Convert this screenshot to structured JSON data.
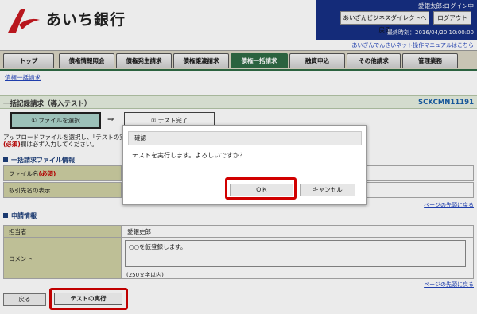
{
  "header": {
    "bank_name": "あいち銀行",
    "user": "愛銀太郎:ログイン中",
    "back_label": "あいぎんビジネスダイレクトへ戻る",
    "logout_label": "ログアウト",
    "last_login": "最終時刻：2016/04/20 10:00:00",
    "manual_link": "あいぎんでんさいネット操作マニュアルはこちら"
  },
  "tabs": [
    "トップ",
    "債権情報照会",
    "債権発生請求",
    "債権譲渡請求",
    "債権一括請求",
    "融資申込",
    "その他請求",
    "管理業務"
  ],
  "active_tab": "債権一括請求",
  "subnav": "債権一括請求",
  "page": {
    "title": "一括記録請求（導入テスト）",
    "screen_id": "SCKCMN11191"
  },
  "steps": {
    "step1": "① ファイルを選択",
    "arrow": "⇒",
    "step2": "② テスト完了"
  },
  "instructions": {
    "line1": "アップロードファイルを選択し、「テストの実行」",
    "req": "(必須)",
    "line2": "欄は必ず入力してください。"
  },
  "file_section": {
    "heading": "一括請求ファイル情報",
    "rows": [
      {
        "label": "ファイル名",
        "req": "(必須)",
        "value": ""
      },
      {
        "label": "取引先名の表示",
        "value": ""
      }
    ],
    "pagetop": "ページの先頭に戻る"
  },
  "apply_section": {
    "heading": "申請情報",
    "rows": [
      {
        "label": "担当者",
        "value": "愛銀史郎"
      },
      {
        "label": "コメント",
        "value": ""
      }
    ],
    "comment_text": "○○を仮登録します。",
    "limit": "(250文字以内)",
    "pagetop": "ページの先頭に戻る"
  },
  "buttons": {
    "return": "戻る",
    "execute": "テストの実行"
  },
  "modal": {
    "title": "確認",
    "message": "テストを実行します。よろしいですか？",
    "ok": "ＯＫ",
    "cancel": "キャンセル"
  },
  "colors": {
    "header_navy": "#162f84",
    "tab_active": "#2f6b45",
    "label_bg": "#cfd0a3",
    "highlight_red": "#d10000",
    "step_active": "#aad2c9"
  }
}
